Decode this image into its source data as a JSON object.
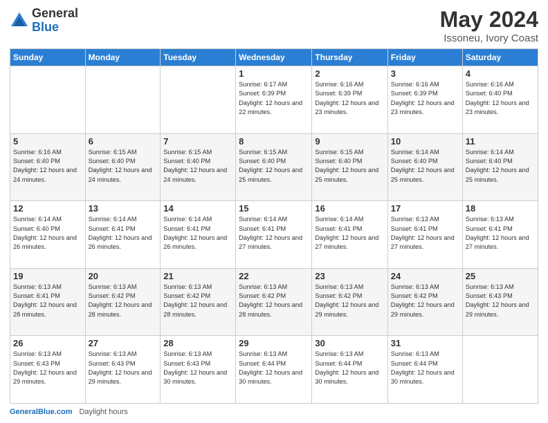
{
  "header": {
    "logo_general": "General",
    "logo_blue": "Blue",
    "main_title": "May 2024",
    "subtitle": "Issoneu, Ivory Coast"
  },
  "days_of_week": [
    "Sunday",
    "Monday",
    "Tuesday",
    "Wednesday",
    "Thursday",
    "Friday",
    "Saturday"
  ],
  "weeks": [
    [
      {
        "day": "",
        "info": ""
      },
      {
        "day": "",
        "info": ""
      },
      {
        "day": "",
        "info": ""
      },
      {
        "day": "1",
        "info": "Sunrise: 6:17 AM\nSunset: 6:39 PM\nDaylight: 12 hours\nand 22 minutes."
      },
      {
        "day": "2",
        "info": "Sunrise: 6:16 AM\nSunset: 6:39 PM\nDaylight: 12 hours\nand 23 minutes."
      },
      {
        "day": "3",
        "info": "Sunrise: 6:16 AM\nSunset: 6:39 PM\nDaylight: 12 hours\nand 23 minutes."
      },
      {
        "day": "4",
        "info": "Sunrise: 6:16 AM\nSunset: 6:40 PM\nDaylight: 12 hours\nand 23 minutes."
      }
    ],
    [
      {
        "day": "5",
        "info": "Sunrise: 6:16 AM\nSunset: 6:40 PM\nDaylight: 12 hours\nand 24 minutes."
      },
      {
        "day": "6",
        "info": "Sunrise: 6:15 AM\nSunset: 6:40 PM\nDaylight: 12 hours\nand 24 minutes."
      },
      {
        "day": "7",
        "info": "Sunrise: 6:15 AM\nSunset: 6:40 PM\nDaylight: 12 hours\nand 24 minutes."
      },
      {
        "day": "8",
        "info": "Sunrise: 6:15 AM\nSunset: 6:40 PM\nDaylight: 12 hours\nand 25 minutes."
      },
      {
        "day": "9",
        "info": "Sunrise: 6:15 AM\nSunset: 6:40 PM\nDaylight: 12 hours\nand 25 minutes."
      },
      {
        "day": "10",
        "info": "Sunrise: 6:14 AM\nSunset: 6:40 PM\nDaylight: 12 hours\nand 25 minutes."
      },
      {
        "day": "11",
        "info": "Sunrise: 6:14 AM\nSunset: 6:40 PM\nDaylight: 12 hours\nand 25 minutes."
      }
    ],
    [
      {
        "day": "12",
        "info": "Sunrise: 6:14 AM\nSunset: 6:40 PM\nDaylight: 12 hours\nand 26 minutes."
      },
      {
        "day": "13",
        "info": "Sunrise: 6:14 AM\nSunset: 6:41 PM\nDaylight: 12 hours\nand 26 minutes."
      },
      {
        "day": "14",
        "info": "Sunrise: 6:14 AM\nSunset: 6:41 PM\nDaylight: 12 hours\nand 26 minutes."
      },
      {
        "day": "15",
        "info": "Sunrise: 6:14 AM\nSunset: 6:41 PM\nDaylight: 12 hours\nand 27 minutes."
      },
      {
        "day": "16",
        "info": "Sunrise: 6:14 AM\nSunset: 6:41 PM\nDaylight: 12 hours\nand 27 minutes."
      },
      {
        "day": "17",
        "info": "Sunrise: 6:13 AM\nSunset: 6:41 PM\nDaylight: 12 hours\nand 27 minutes."
      },
      {
        "day": "18",
        "info": "Sunrise: 6:13 AM\nSunset: 6:41 PM\nDaylight: 12 hours\nand 27 minutes."
      }
    ],
    [
      {
        "day": "19",
        "info": "Sunrise: 6:13 AM\nSunset: 6:41 PM\nDaylight: 12 hours\nand 28 minutes."
      },
      {
        "day": "20",
        "info": "Sunrise: 6:13 AM\nSunset: 6:42 PM\nDaylight: 12 hours\nand 28 minutes."
      },
      {
        "day": "21",
        "info": "Sunrise: 6:13 AM\nSunset: 6:42 PM\nDaylight: 12 hours\nand 28 minutes."
      },
      {
        "day": "22",
        "info": "Sunrise: 6:13 AM\nSunset: 6:42 PM\nDaylight: 12 hours\nand 28 minutes."
      },
      {
        "day": "23",
        "info": "Sunrise: 6:13 AM\nSunset: 6:42 PM\nDaylight: 12 hours\nand 29 minutes."
      },
      {
        "day": "24",
        "info": "Sunrise: 6:13 AM\nSunset: 6:42 PM\nDaylight: 12 hours\nand 29 minutes."
      },
      {
        "day": "25",
        "info": "Sunrise: 6:13 AM\nSunset: 6:43 PM\nDaylight: 12 hours\nand 29 minutes."
      }
    ],
    [
      {
        "day": "26",
        "info": "Sunrise: 6:13 AM\nSunset: 6:43 PM\nDaylight: 12 hours\nand 29 minutes."
      },
      {
        "day": "27",
        "info": "Sunrise: 6:13 AM\nSunset: 6:43 PM\nDaylight: 12 hours\nand 29 minutes."
      },
      {
        "day": "28",
        "info": "Sunrise: 6:13 AM\nSunset: 6:43 PM\nDaylight: 12 hours\nand 30 minutes."
      },
      {
        "day": "29",
        "info": "Sunrise: 6:13 AM\nSunset: 6:44 PM\nDaylight: 12 hours\nand 30 minutes."
      },
      {
        "day": "30",
        "info": "Sunrise: 6:13 AM\nSunset: 6:44 PM\nDaylight: 12 hours\nand 30 minutes."
      },
      {
        "day": "31",
        "info": "Sunrise: 6:13 AM\nSunset: 6:44 PM\nDaylight: 12 hours\nand 30 minutes."
      },
      {
        "day": "",
        "info": ""
      }
    ]
  ],
  "footer": {
    "site": "GeneralBlue.com",
    "daylight_label": "Daylight hours"
  }
}
